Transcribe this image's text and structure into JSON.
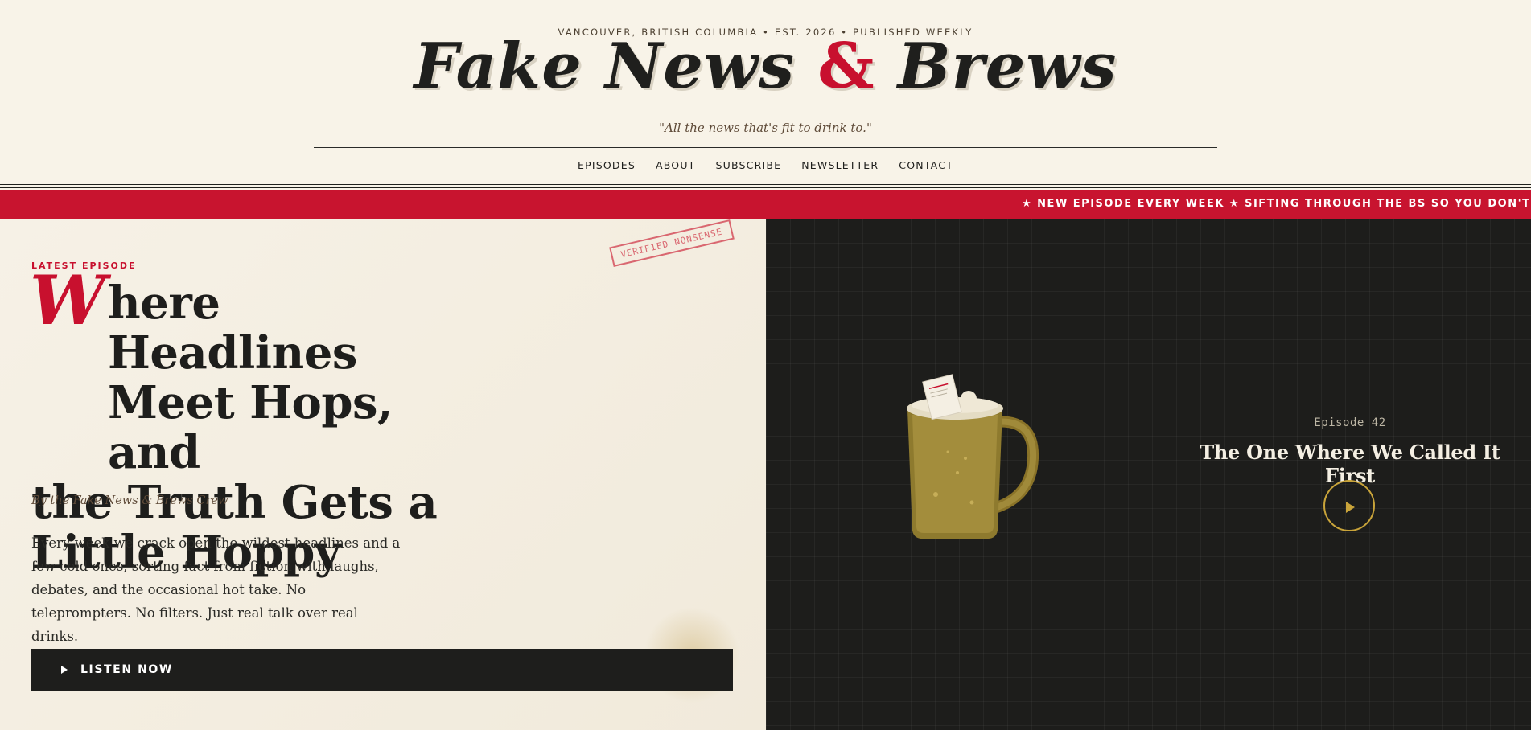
{
  "masthead": {
    "dateline": "VANCOUVER, BRITISH COLUMBIA • EST. 2026 • PUBLISHED WEEKLY",
    "logo_part1": "Fake News",
    "logo_amp": "&",
    "logo_part2": "Brews",
    "tagline": "\"All the news that's fit to drink to.\""
  },
  "nav": {
    "items": [
      "EPISODES",
      "ABOUT",
      "SUBSCRIBE",
      "NEWSLETTER",
      "CONTACT"
    ]
  },
  "ticker": {
    "text": "★ NEW EPISODE EVERY WEEK ★ SIFTING THROUGH THE BS SO YOU DON'T HAVE TO ★ C"
  },
  "hero": {
    "stamp": "VERIFIED NONSENSE",
    "kicker": "LATEST EPISODE",
    "dropcap": "W",
    "headline_l1": "here Headlines",
    "headline_l2": "Meet Hops, and",
    "headline_l3": "the Truth Gets a",
    "headline_l4": "Little Hoppy",
    "byline": "By the Fake News & Brews Crew",
    "blurb": "Every week we crack open the wildest headlines and a few cold ones, sorting fact from fiction with laughs, debates, and the occasional hot take. No teleprompters. No filters. Just real talk over real drinks.",
    "cta_label": "LISTEN NOW"
  },
  "episode": {
    "number": "Episode 42",
    "title": "The One Where We Called It First"
  },
  "colors": {
    "accent": "#c8102e",
    "gold": "#c9a43a",
    "dark": "#1e1e1c",
    "paper": "#f7f2e7"
  },
  "icons": {
    "cta": "play-icon",
    "episode": "play-circle-icon",
    "art": "beer-mug-icon"
  }
}
